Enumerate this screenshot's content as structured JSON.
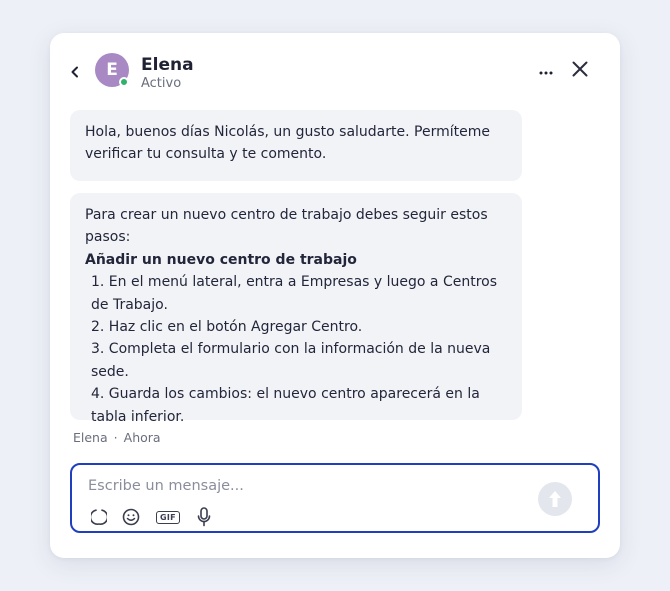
{
  "header": {
    "back_icon": "chevron-left-icon",
    "avatar_initial": "E",
    "avatar_color": "#a889c4",
    "status_color": "#2fb36b",
    "name": "Elena",
    "status": "Activo",
    "more_icon": "more-horizontal-icon",
    "close_icon": "close-icon"
  },
  "messages": [
    {
      "text": "Hola, buenos días Nicolás, un gusto saludarte. Permíteme verificar tu consulta y te comento."
    },
    {
      "intro": "Para crear un nuevo centro de trabajo debes seguir estos pasos:",
      "heading": "Añadir un nuevo centro de trabajo",
      "steps": [
        "1. En el menú lateral, entra a Empresas y luego a Centros de Trabajo.",
        "2. Haz clic en el botón Agregar Centro.",
        "3. Completa el formulario con la información de la nueva sede.",
        "4. Guarda los cambios: el nuevo centro aparecerá en la tabla inferior."
      ]
    }
  ],
  "meta": {
    "sender": "Elena",
    "separator": "·",
    "time": "Ahora"
  },
  "composer": {
    "placeholder": "Escribe un mensaje...",
    "value": "",
    "border_color": "#1f3fbf",
    "send_icon": "arrow-up-icon",
    "tools": [
      "loading-icon",
      "emoji-icon",
      "gif-icon",
      "microphone-icon"
    ],
    "gif_label": "GIF"
  }
}
